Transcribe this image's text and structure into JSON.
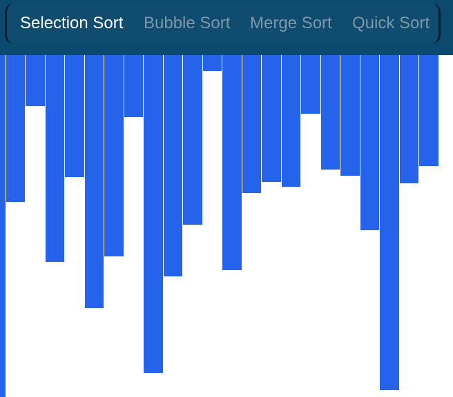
{
  "header": {
    "tabs": [
      {
        "label": "Selection Sort",
        "active": true
      },
      {
        "label": "Bubble Sort",
        "active": false
      },
      {
        "label": "Merge Sort",
        "active": false
      },
      {
        "label": "Quick Sort",
        "active": false
      }
    ]
  },
  "visualizer": {
    "bar_color": "#2563eb",
    "values": [
      496,
      213,
      74,
      300,
      177,
      367,
      292,
      90,
      461,
      321,
      246,
      23,
      312,
      200,
      184,
      191,
      85,
      166,
      175,
      254,
      486,
      186,
      161
    ]
  }
}
